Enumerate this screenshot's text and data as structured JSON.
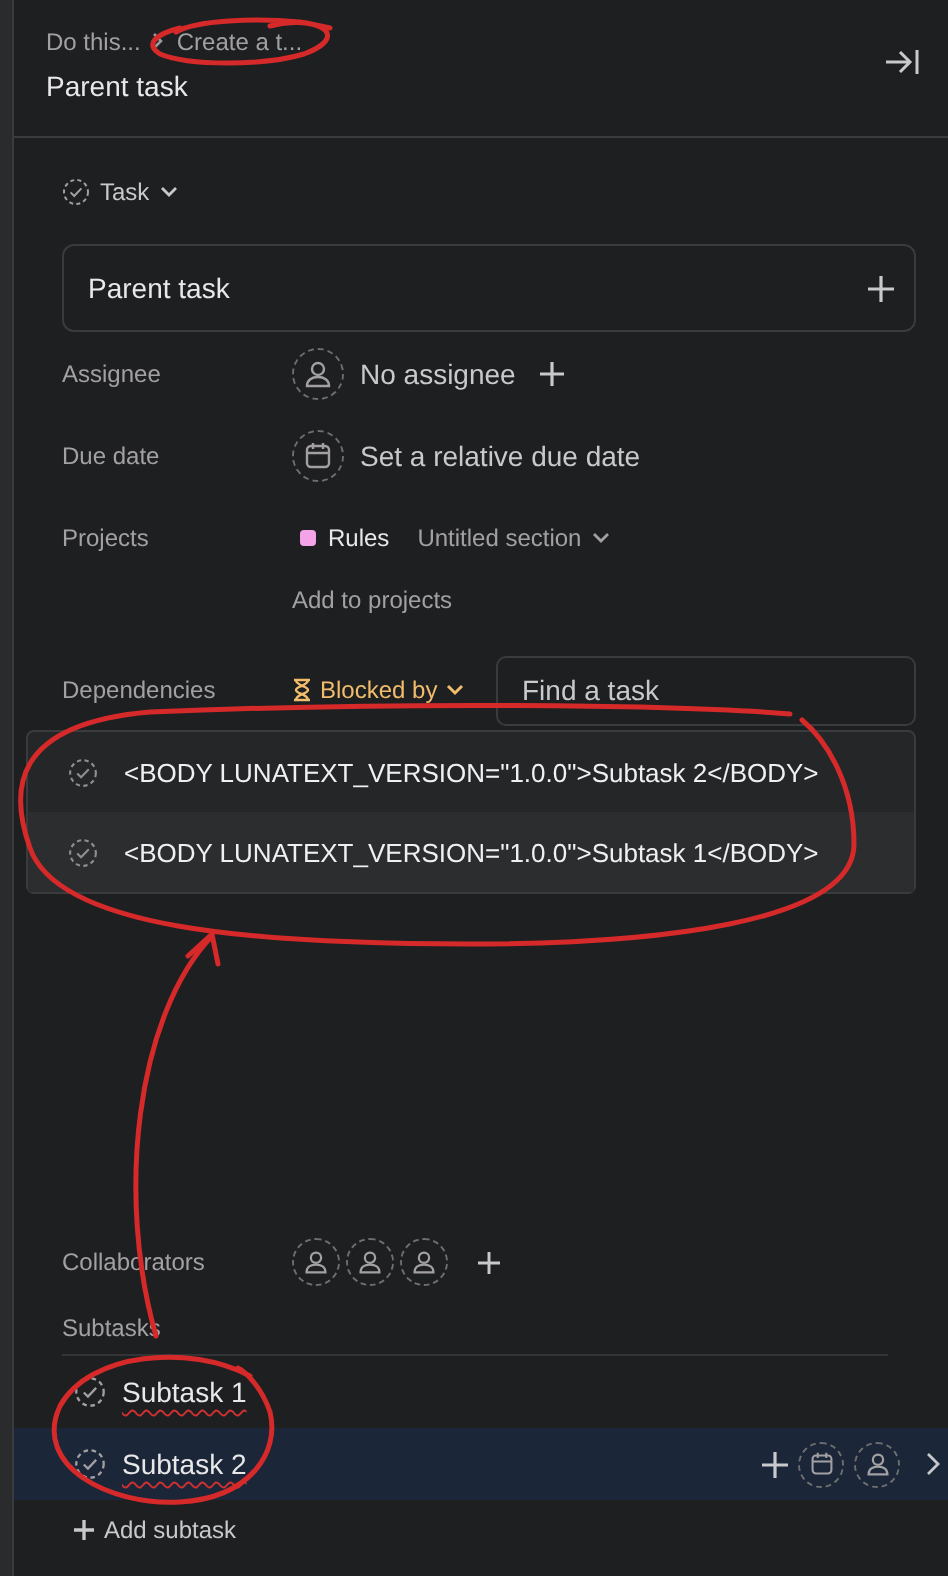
{
  "breadcrumb": [
    {
      "label": "Do this..."
    },
    {
      "label": "Create a t..."
    }
  ],
  "title": "Parent task",
  "task_type": {
    "label": "Task"
  },
  "name_field": {
    "value": "Parent task"
  },
  "assignee": {
    "label": "Assignee",
    "value": "No assignee"
  },
  "due_date": {
    "label": "Due date",
    "value": "Set a relative due date"
  },
  "projects": {
    "label": "Projects",
    "items": [
      {
        "name": "Rules",
        "color": "#f5a3e8",
        "section": "Untitled section"
      }
    ],
    "add_label": "Add to projects"
  },
  "dependencies": {
    "label": "Dependencies",
    "mode": "Blocked by",
    "search": {
      "placeholder": "Find a task"
    },
    "results": [
      {
        "text": "<BODY LUNATEXT_VERSION=\"1.0.0\">Subtask 2</BODY>",
        "selected": false
      },
      {
        "text": "<BODY LUNATEXT_VERSION=\"1.0.0\">Subtask 1</BODY>",
        "selected": true
      }
    ]
  },
  "collaborators": {
    "label": "Collaborators"
  },
  "subtasks": {
    "label": "Subtasks",
    "items": [
      {
        "name": "Subtask 1",
        "selected": false
      },
      {
        "name": "Subtask 2",
        "selected": true
      }
    ],
    "add_label": "Add subtask"
  }
}
